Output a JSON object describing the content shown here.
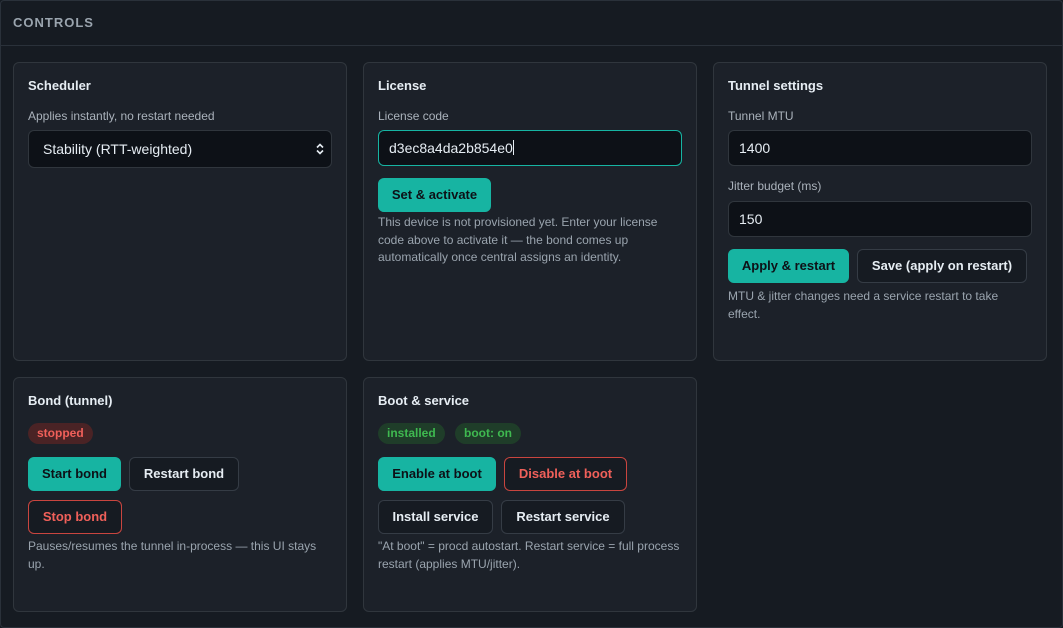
{
  "header": {
    "title": "CONTROLS"
  },
  "scheduler": {
    "title": "Scheduler",
    "label": "Applies instantly, no restart needed",
    "selected": "Stability (RTT-weighted)",
    "chevron_icon": "chevron-up-down-icon"
  },
  "license": {
    "title": "License",
    "field_label": "License code",
    "value": "d3ec8a4da2b854e0",
    "button": "Set & activate",
    "note": "This device is not provisioned yet. Enter your license code above to activate it — the bond comes up automatically once central assigns an identity."
  },
  "tunnel": {
    "title": "Tunnel settings",
    "mtu_label": "Tunnel MTU",
    "mtu_value": "1400",
    "jitter_label": "Jitter budget (ms)",
    "jitter_value": "150",
    "apply_button": "Apply & restart",
    "save_button": "Save (apply on restart)",
    "note": "MTU & jitter changes need a service restart to take effect."
  },
  "bond": {
    "title": "Bond (tunnel)",
    "status": "stopped",
    "start_button": "Start bond",
    "restart_button": "Restart bond",
    "stop_button": "Stop bond",
    "note": "Pauses/resumes the tunnel in-process — this UI stays up."
  },
  "boot": {
    "title": "Boot & service",
    "badge_installed": "installed",
    "badge_boot": "boot: on",
    "enable_button": "Enable at boot",
    "disable_button": "Disable at boot",
    "install_button": "Install service",
    "restart_button": "Restart service",
    "note": "\"At boot\" = procd autostart. Restart service = full process restart (applies MTU/jitter)."
  },
  "colors": {
    "accent": "#17b4a2",
    "danger": "#f0605a",
    "success": "#3fb950",
    "background": "#161b22",
    "card": "#1c2129"
  }
}
